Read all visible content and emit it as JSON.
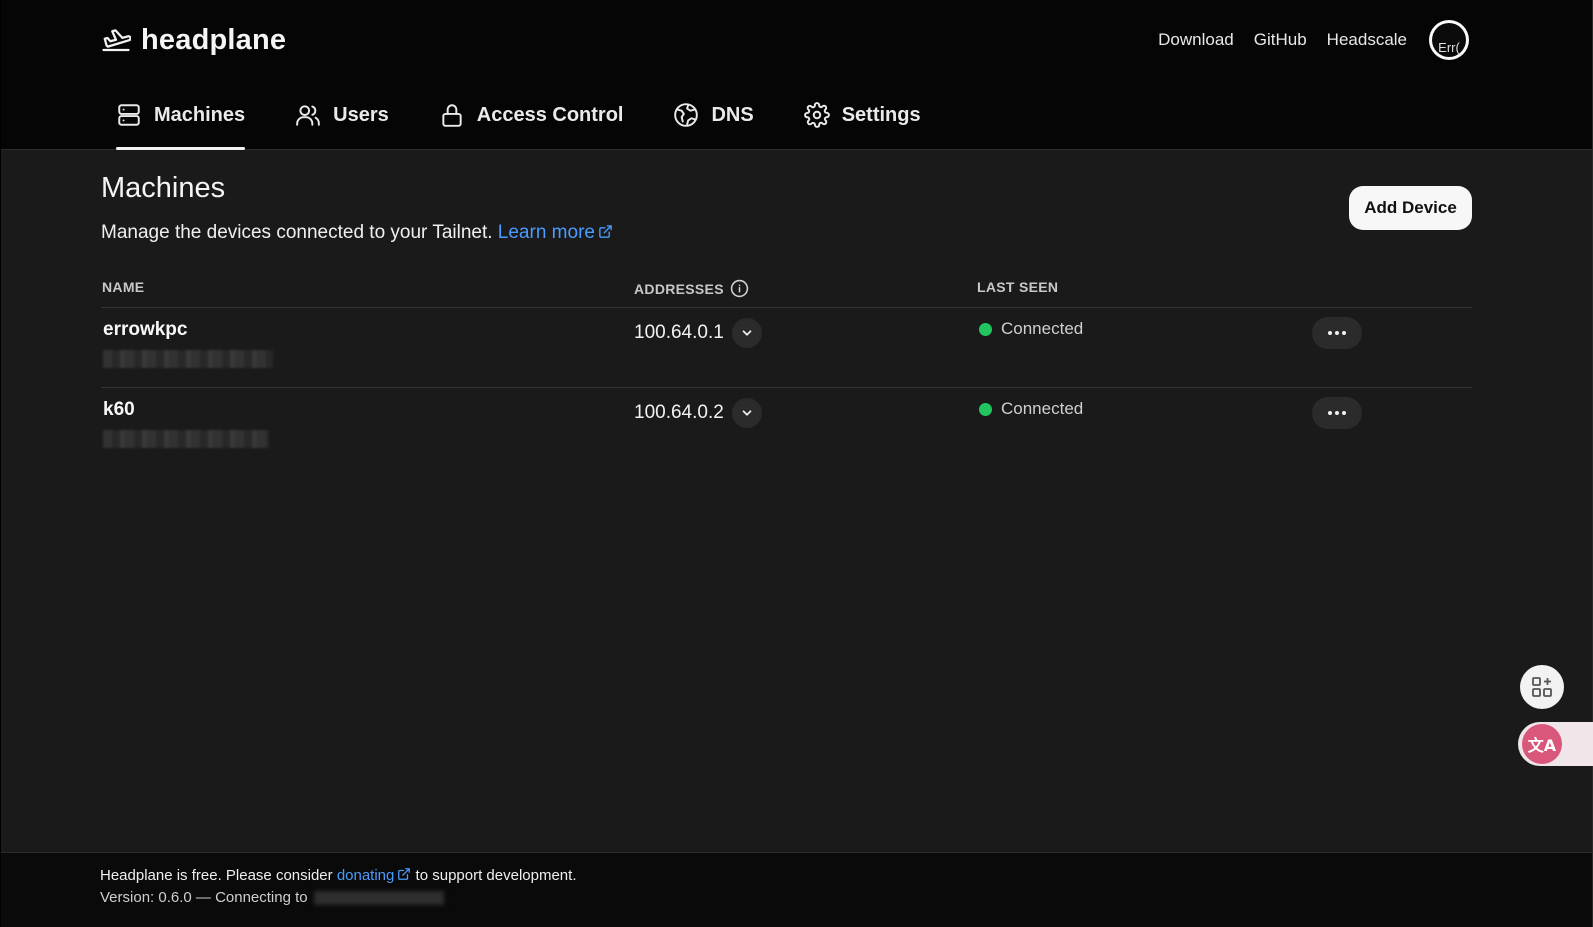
{
  "brand": {
    "name": "headplane"
  },
  "top_links": [
    "Download",
    "GitHub",
    "Headscale"
  ],
  "avatar": {
    "alt_text": "Err("
  },
  "tabs": [
    {
      "label": "Machines",
      "icon": "server-icon",
      "active": true
    },
    {
      "label": "Users",
      "icon": "users-icon",
      "active": false
    },
    {
      "label": "Access Control",
      "icon": "lock-icon",
      "active": false
    },
    {
      "label": "DNS",
      "icon": "globe-icon",
      "active": false
    },
    {
      "label": "Settings",
      "icon": "gear-icon",
      "active": false
    }
  ],
  "page": {
    "title": "Machines",
    "description": "Manage the devices connected to your Tailnet.",
    "learn_more": "Learn more",
    "add_device_label": "Add Device"
  },
  "table": {
    "headers": {
      "name": "NAME",
      "addresses": "ADDRESSES",
      "last_seen": "LAST SEEN"
    },
    "rows": [
      {
        "name": "errowkpc",
        "address": "100.64.0.1",
        "status": "Connected"
      },
      {
        "name": "k60",
        "address": "100.64.0.2",
        "status": "Connected"
      }
    ]
  },
  "footer": {
    "line1_prefix": "Headplane is free. Please consider",
    "donate_link": "donating",
    "line1_suffix": "to support development.",
    "line2": "Version: 0.6.0 — Connecting to"
  },
  "colors": {
    "accent_link": "#4b9bff",
    "status_connected": "#22c55e",
    "background": "#1a1a1a",
    "translate_widget": "#d9577a"
  }
}
